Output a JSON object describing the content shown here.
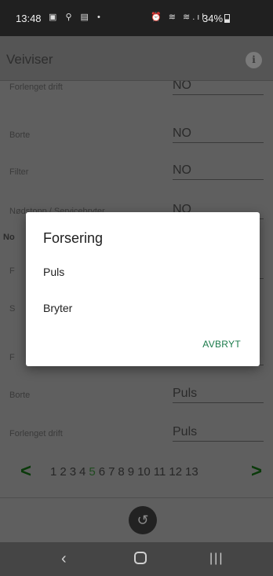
{
  "status_bar": {
    "time": "13:48",
    "left_icons": "▣ ⚲ ▤ •",
    "right_icons": "⏰ ≋ ≋.ıl",
    "battery": "34%"
  },
  "app_bar": {
    "title": "Veiviser",
    "info_label": "i"
  },
  "rows": [
    {
      "label": "Forlenget drift",
      "value": "NO"
    },
    {
      "label": "Borte",
      "value": "NO"
    },
    {
      "label": "Filter",
      "value": "NO"
    },
    {
      "label": "Nødstopp / Servicebryter",
      "value": "NO"
    },
    {
      "label": "F",
      "value": ""
    },
    {
      "label": "S",
      "value": ""
    },
    {
      "label": "F",
      "value": ""
    },
    {
      "label": "Borte",
      "value": "Puls"
    },
    {
      "label": "Forlenget drift",
      "value": "Puls"
    }
  ],
  "section_title": "No",
  "pager": {
    "prev": "<",
    "next": ">",
    "pages": [
      "1",
      "2",
      "3",
      "4",
      "5",
      "6",
      "7",
      "8",
      "9",
      "10",
      "11",
      "12",
      "13"
    ],
    "active_page": "5"
  },
  "back_fab": "↺",
  "nav_bar": {
    "back": "‹",
    "recent": "|||"
  },
  "dialog": {
    "title": "Forsering",
    "options": [
      "Puls",
      "Bryter"
    ],
    "cancel": "AVBRYT"
  },
  "colors": {
    "accent": "#1a7a4a",
    "pager_active": "#1e4a1e",
    "pager_arrows": "#0a3a0a"
  }
}
